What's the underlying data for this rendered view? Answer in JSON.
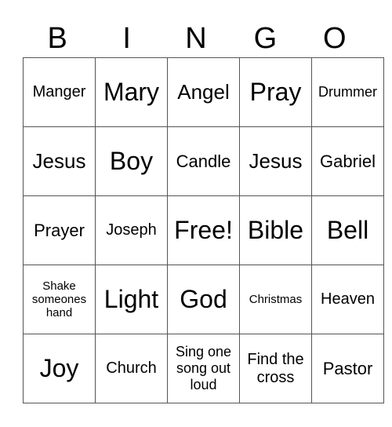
{
  "header": [
    "B",
    "I",
    "N",
    "G",
    "O"
  ],
  "cells": [
    [
      {
        "t": "Manger",
        "s": "s5"
      },
      {
        "t": "Mary",
        "s": "s2"
      },
      {
        "t": "Angel",
        "s": "s3"
      },
      {
        "t": "Pray",
        "s": "s2"
      },
      {
        "t": "Drummer",
        "s": "s6"
      }
    ],
    [
      {
        "t": "Jesus",
        "s": "s3"
      },
      {
        "t": "Boy",
        "s": "s2"
      },
      {
        "t": "Candle",
        "s": "s4"
      },
      {
        "t": "Jesus",
        "s": "s3"
      },
      {
        "t": "Gabriel",
        "s": "s4"
      }
    ],
    [
      {
        "t": "Prayer",
        "s": "s4"
      },
      {
        "t": "Joseph",
        "s": "s5"
      },
      {
        "t": "Free!",
        "s": "s2"
      },
      {
        "t": "Bible",
        "s": "s2"
      },
      {
        "t": "Bell",
        "s": "s2"
      }
    ],
    [
      {
        "t": "Shake someones hand",
        "s": "s7"
      },
      {
        "t": "Light",
        "s": "s2"
      },
      {
        "t": "God",
        "s": "s2"
      },
      {
        "t": "Christmas",
        "s": "s7"
      },
      {
        "t": "Heaven",
        "s": "s5"
      }
    ],
    [
      {
        "t": "Joy",
        "s": "s2"
      },
      {
        "t": "Church",
        "s": "s5"
      },
      {
        "t": "Sing one song out loud",
        "s": "s6"
      },
      {
        "t": "Find the cross",
        "s": "s5"
      },
      {
        "t": "Pastor",
        "s": "s4"
      }
    ]
  ]
}
